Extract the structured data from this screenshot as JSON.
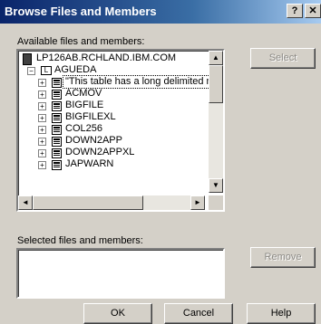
{
  "window": {
    "title": "Browse Files and Members",
    "help_btn": "?",
    "close_btn": "✕"
  },
  "available": {
    "label": "Available files and members:",
    "system": "LP126AB.RCHLAND.IBM.COM",
    "library": "AGUEDA",
    "items": [
      "\"This table has a long delimited name\"",
      "ACMOV",
      "BIGFILE",
      "BIGFILEXL",
      "COL256",
      "DOWN2APP",
      "DOWN2APPXL",
      "JAPWARN"
    ]
  },
  "selected": {
    "label": "Selected files and members:"
  },
  "buttons": {
    "select": "Select",
    "remove": "Remove",
    "ok": "OK",
    "cancel": "Cancel",
    "help": "Help"
  },
  "icons": {
    "expand": "+",
    "collapse": "−",
    "up": "▲",
    "down": "▼",
    "left": "◄",
    "right": "►"
  }
}
